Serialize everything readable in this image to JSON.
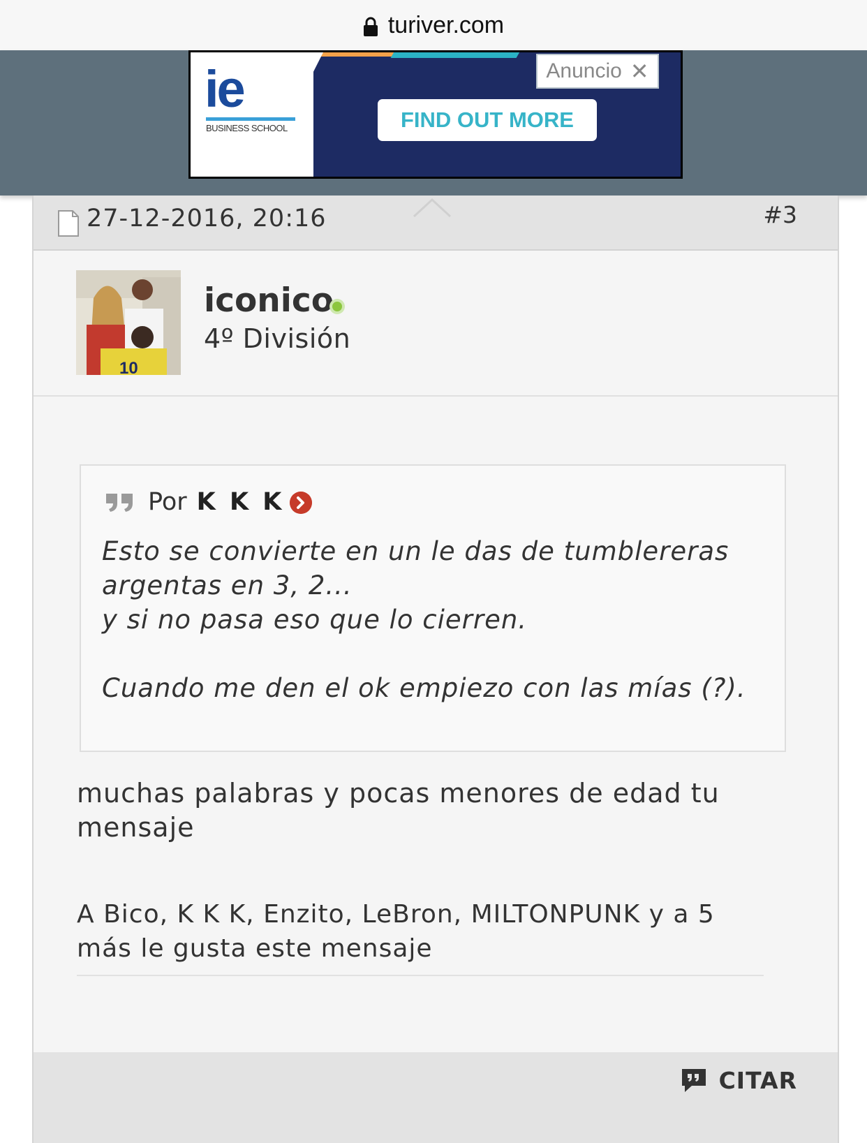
{
  "browser": {
    "url": "turiver.com",
    "lock_icon": "lock-icon"
  },
  "ad": {
    "brand_logo": "ie",
    "brand_sub": "BUSINESS SCHOOL",
    "cta_label": "FIND OUT MORE",
    "ad_label": "Anuncio",
    "close_icon": "close-icon",
    "colors": {
      "background": "#1d2b63",
      "cta_text": "#37b4c8",
      "band": "#5e707c"
    }
  },
  "post": {
    "date": "27-12-2016, 20:16",
    "number": "#3",
    "author": {
      "name": "iconico",
      "rank": "4º División",
      "online": true
    },
    "quote": {
      "prefix": "Por",
      "author": "K K K",
      "lines": [
        "Esto se convierte en un le das de tumblereras argentas en 3, 2...",
        "y si no pasa eso que lo cierren.",
        "Cuando me den el ok empiezo con las mías (?)."
      ]
    },
    "message": "muchas palabras y pocas menores de edad tu mensaje",
    "likes": "A Bico, K K K, Enzito, LeBron, MILTONPUNK y a 5 más le gusta este mensaje",
    "quote_button": "CITAR"
  }
}
